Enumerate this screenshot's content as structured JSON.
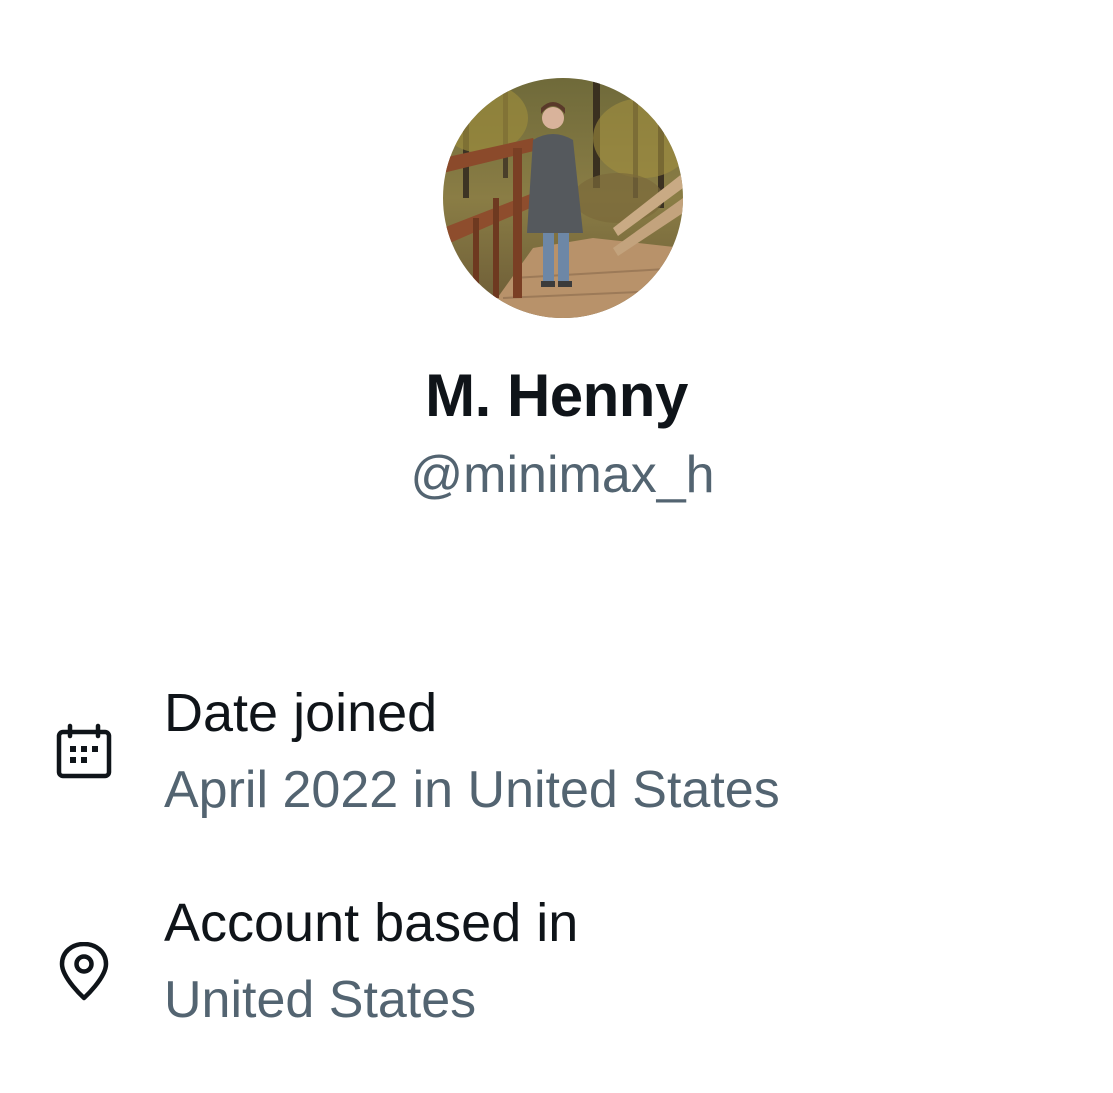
{
  "profile": {
    "display_name": "M. Henny",
    "handle": "@minimax_h",
    "avatar": "profile-photo"
  },
  "about": {
    "date_joined": {
      "icon": "calendar-icon",
      "title": "Date joined",
      "value": "April 2022 in United States"
    },
    "account_based": {
      "icon": "location-pin-icon",
      "title": "Account based in",
      "value": "United States"
    }
  },
  "colors": {
    "primary_text": "#0f1419",
    "secondary_text": "#536471",
    "background": "#ffffff"
  }
}
